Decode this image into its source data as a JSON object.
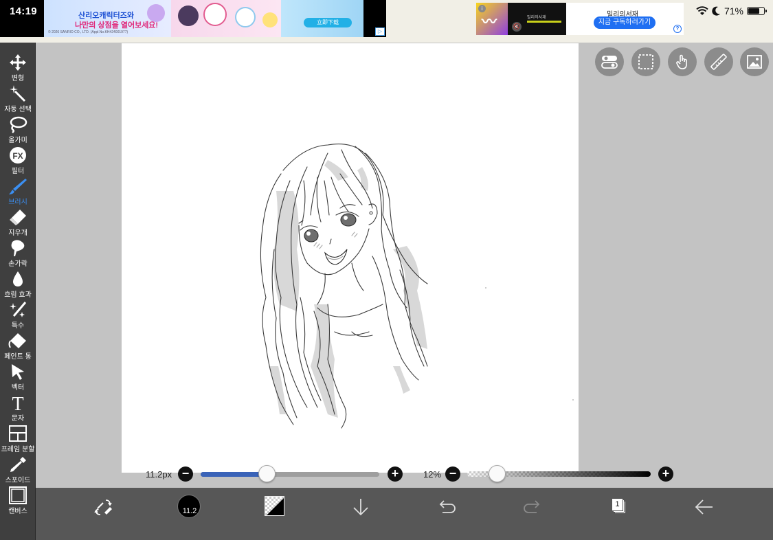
{
  "status": {
    "time": "14:19",
    "battery_pct": "71%",
    "battery_level": 0.71
  },
  "ads": {
    "left": {
      "line1": "산리오캐릭터즈와",
      "line2": "나만의 상점을 열어보세요!",
      "button": "立即下载",
      "fine_print": "© 2026 SANRIO CO., LTD. (Appl.No.KH#24001977)"
    },
    "right": {
      "brand": "밀리의서재",
      "cta": "지금 구독하러가기",
      "video_text": "밀리의서재"
    }
  },
  "toolbar": {
    "items": [
      {
        "label": "변형",
        "icon": "move-icon"
      },
      {
        "label": "자동 선택",
        "icon": "magic-wand-icon"
      },
      {
        "label": "올가미",
        "icon": "lasso-icon"
      },
      {
        "label": "필터",
        "icon": "fx-icon"
      },
      {
        "label": "브러시",
        "icon": "brush-icon",
        "active": true
      },
      {
        "label": "지우개",
        "icon": "eraser-icon"
      },
      {
        "label": "손가락",
        "icon": "finger-icon"
      },
      {
        "label": "흐림 효과",
        "icon": "blur-drop-icon"
      },
      {
        "label": "특수",
        "icon": "sparkle-wand-icon"
      },
      {
        "label": "페인트 통",
        "icon": "paint-bucket-icon"
      },
      {
        "label": "벡터",
        "icon": "vector-arrow-icon"
      },
      {
        "label": "문자",
        "icon": "text-icon"
      },
      {
        "label": "프레임 분할",
        "icon": "frame-split-icon"
      },
      {
        "label": "스포이드",
        "icon": "eyedropper-icon"
      },
      {
        "label": "캔버스",
        "icon": "canvas-icon"
      }
    ]
  },
  "sliders": {
    "brush_size_label": "11.2px",
    "brush_size_fraction": 0.37,
    "opacity_label": "12%",
    "opacity_fraction": 0.12
  },
  "bottombar": {
    "brush_size_badge": "11.2",
    "layer_count": "1",
    "colors": {
      "primary": "#000000",
      "secondary": "transparent",
      "accent": "#3a63b8",
      "active_tool": "#3b8ff2"
    }
  }
}
